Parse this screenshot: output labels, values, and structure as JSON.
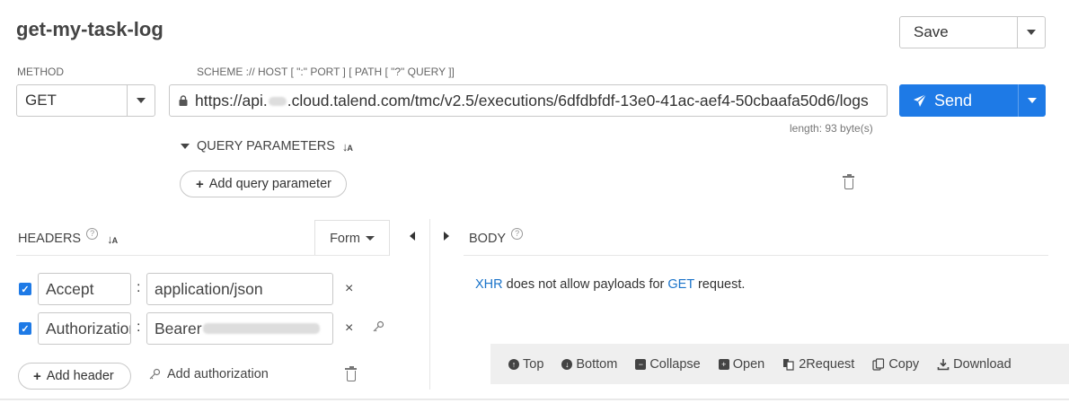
{
  "request": {
    "title": "get-my-task-log",
    "method_label": "METHOD",
    "method_value": "GET",
    "url_label": "SCHEME :// HOST [ \":\" PORT ] [ PATH [ \"?\" QUERY ]]",
    "url_prefix": "https://api.",
    "url_suffix": ".cloud.talend.com/tmc/v2.5/executions/6dfdbfdf-13e0-41ac-aef4-50cbaafa50d6/logs",
    "length": "length: 93 byte(s)"
  },
  "actions": {
    "save_label": "Save",
    "send_label": "Send"
  },
  "query": {
    "section_label": "QUERY PARAMETERS",
    "add_label": "Add query parameter"
  },
  "headers": {
    "section_label": "HEADERS",
    "form_label": "Form",
    "rows": [
      {
        "enabled": true,
        "name": "Accept",
        "value": "application/json"
      },
      {
        "enabled": true,
        "name": "Authorization",
        "value": "Bearer "
      }
    ],
    "add_header_label": "Add header",
    "add_auth_label": "Add authorization"
  },
  "body": {
    "section_label": "BODY",
    "msg_xhr": "XHR",
    "msg_mid": " does not allow payloads for ",
    "msg_get": "GET",
    "msg_end": " request."
  },
  "toolbar": {
    "top": "Top",
    "bottom": "Bottom",
    "collapse": "Collapse",
    "open": "Open",
    "to_request": "2Request",
    "copy": "Copy",
    "download": "Download"
  },
  "colors": {
    "accent": "#1e7ae6",
    "link": "#1a73c9"
  }
}
